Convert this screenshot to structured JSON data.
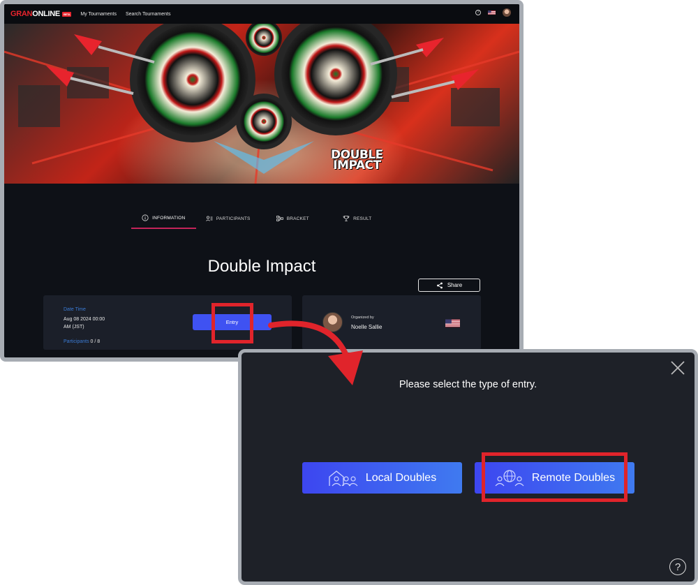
{
  "nav": {
    "logo_part1": "GRAN",
    "logo_part2": "ONLINE",
    "beta_badge": "BETA",
    "links": [
      "My Tournaments",
      "Search Tournaments"
    ],
    "help_icon": "?"
  },
  "banner": {
    "title_line1": "DOUBLE",
    "title_line2": "IMPACT"
  },
  "tabs": [
    {
      "label": "INFORMATION",
      "icon": "info-icon",
      "active": true
    },
    {
      "label": "PARTICIPANTS",
      "icon": "participants-icon",
      "active": false
    },
    {
      "label": "BRACKET",
      "icon": "bracket-icon",
      "active": false
    },
    {
      "label": "RESULT",
      "icon": "trophy-icon",
      "active": false
    }
  ],
  "tournament": {
    "title": "Double Impact",
    "share_label": "Share",
    "date_label": "Date Time",
    "date_value_line1": "Aug 08 2024 00:00",
    "date_value_line2": "AM (JST)",
    "participants_label": "Participants",
    "participants_value": "0 / 8",
    "entry_label": "Entry",
    "organized_by_label": "Organized by",
    "organizer_name": "Noelle Sallie"
  },
  "dialog": {
    "prompt": "Please select the type of entry.",
    "local_label": "Local Doubles",
    "remote_label": "Remote Doubles",
    "help_icon": "?"
  },
  "colors": {
    "accent_blue": "#3f52f2",
    "brand_red": "#e8242d",
    "highlight_red": "#e0242b",
    "tab_underline": "#c4245a"
  }
}
